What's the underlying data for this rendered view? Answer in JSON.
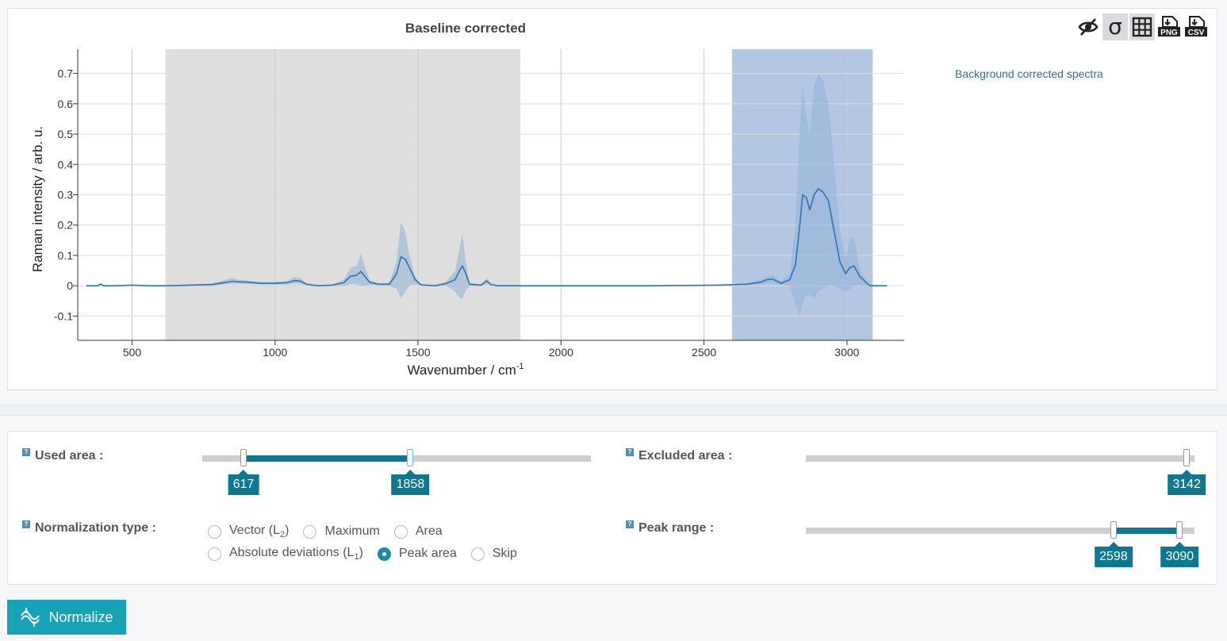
{
  "chart_data": {
    "type": "line",
    "title": "Baseline corrected",
    "xlabel": "Wavenumber / cm",
    "xlabel_sup": "-1",
    "ylabel": "Raman intensity / arb. u.",
    "xlim": [
      310,
      3200
    ],
    "ylim": [
      -0.18,
      0.78
    ],
    "xticks": [
      500,
      1000,
      1500,
      2000,
      2500,
      3000
    ],
    "yticks": [
      -0.1,
      0,
      0.1,
      0.2,
      0.3,
      0.4,
      0.5,
      0.6,
      0.7
    ],
    "ytick_labels": [
      "-0.1",
      "0",
      "0.1",
      "0.2",
      "0.3",
      "0.4",
      "0.5",
      "0.6",
      "0.7"
    ],
    "grid": true,
    "regions": [
      {
        "role": "used-area",
        "from": 617,
        "to": 1858,
        "color": "#dedede"
      },
      {
        "role": "peak-range",
        "from": 2598,
        "to": 3090,
        "color": "#b4c7e2"
      }
    ],
    "series": [
      {
        "name": "Background corrected spectra",
        "color": "#2a76b5",
        "x": [
          340,
          380,
          390,
          400,
          440,
          500,
          560,
          600,
          620,
          700,
          780,
          820,
          850,
          870,
          900,
          950,
          1000,
          1040,
          1070,
          1090,
          1110,
          1150,
          1200,
          1240,
          1265,
          1285,
          1300,
          1315,
          1330,
          1360,
          1400,
          1425,
          1440,
          1455,
          1470,
          1490,
          1510,
          1560,
          1600,
          1630,
          1645,
          1655,
          1665,
          1680,
          1720,
          1740,
          1755,
          1780,
          1850,
          2000,
          2300,
          2550,
          2650,
          2700,
          2720,
          2740,
          2770,
          2800,
          2820,
          2835,
          2845,
          2858,
          2870,
          2885,
          2900,
          2915,
          2935,
          2955,
          2975,
          2995,
          3010,
          3025,
          3045,
          3080,
          3140
        ],
        "y": [
          0.0,
          0.0,
          0.006,
          0.0,
          0.0,
          0.002,
          0.0,
          0.0,
          0.0,
          0.002,
          0.004,
          0.01,
          0.015,
          0.013,
          0.012,
          0.008,
          0.008,
          0.01,
          0.017,
          0.015,
          0.005,
          0.0,
          0.002,
          0.01,
          0.032,
          0.034,
          0.047,
          0.03,
          0.012,
          0.005,
          0.005,
          0.04,
          0.095,
          0.088,
          0.06,
          0.02,
          0.003,
          0.0,
          0.008,
          0.02,
          0.05,
          0.065,
          0.045,
          0.005,
          0.002,
          0.016,
          0.004,
          0.0,
          0.0,
          0.0,
          0.0,
          0.002,
          0.005,
          0.012,
          0.02,
          0.022,
          0.008,
          0.02,
          0.07,
          0.2,
          0.3,
          0.29,
          0.25,
          0.3,
          0.32,
          0.31,
          0.28,
          0.18,
          0.08,
          0.04,
          0.06,
          0.065,
          0.03,
          0.0,
          0.0
        ],
        "band_upper": [
          0.0,
          0.0,
          0.008,
          0.0,
          0.0,
          0.003,
          0.0,
          0.0,
          0.0,
          0.004,
          0.008,
          0.018,
          0.026,
          0.02,
          0.018,
          0.012,
          0.012,
          0.016,
          0.03,
          0.025,
          0.008,
          0.0,
          0.004,
          0.02,
          0.06,
          0.065,
          0.105,
          0.06,
          0.02,
          0.008,
          0.01,
          0.08,
          0.21,
          0.18,
          0.1,
          0.03,
          0.005,
          0.0,
          0.015,
          0.05,
          0.12,
          0.175,
          0.09,
          0.01,
          0.004,
          0.025,
          0.006,
          0.0,
          0.0,
          0.0,
          0.0,
          0.003,
          0.008,
          0.02,
          0.03,
          0.035,
          0.015,
          0.04,
          0.2,
          0.52,
          0.66,
          0.56,
          0.5,
          0.66,
          0.7,
          0.68,
          0.6,
          0.4,
          0.18,
          0.09,
          0.15,
          0.16,
          0.05,
          0.0,
          0.0
        ],
        "band_lower": [
          0.0,
          0.0,
          0.004,
          0.0,
          0.0,
          0.001,
          0.0,
          0.0,
          0.0,
          0.0,
          0.0,
          0.004,
          0.007,
          0.006,
          0.006,
          0.004,
          0.004,
          0.004,
          0.007,
          0.006,
          0.002,
          0.0,
          0.0,
          0.0,
          0.005,
          0.005,
          0.0,
          0.0,
          0.002,
          0.002,
          0.0,
          -0.01,
          -0.04,
          -0.02,
          0.0,
          0.005,
          0.001,
          0.0,
          0.0,
          -0.02,
          -0.04,
          -0.045,
          -0.02,
          0.0,
          0.0,
          0.005,
          0.002,
          0.0,
          0.0,
          0.0,
          0.0,
          0.001,
          0.002,
          0.004,
          0.008,
          0.008,
          0.002,
          0.0,
          -0.06,
          -0.1,
          -0.06,
          -0.03,
          -0.03,
          -0.04,
          -0.02,
          -0.01,
          0.0,
          0.0,
          -0.01,
          -0.02,
          -0.01,
          0.0,
          0.0,
          0.0,
          0.0
        ],
        "band_color": "#8fb0d6"
      }
    ]
  },
  "legend": {
    "label": "Background corrected spectra"
  },
  "toolbar": {
    "icons": [
      "eye-slash-icon",
      "sigma-icon",
      "grid-icon",
      "png-download-icon",
      "csv-download-icon"
    ],
    "sigma_glyph": "σ",
    "png_label": "PNG",
    "csv_label": "CSV"
  },
  "controls": {
    "help_glyph": "?",
    "used_area": {
      "label": "Used area :",
      "min": 310,
      "max": 3200,
      "low": 617,
      "high": 1858,
      "low_label": "617",
      "high_label": "1858"
    },
    "excluded_area": {
      "label": "Excluded area :",
      "min": 310,
      "max": 3200,
      "value": 3142,
      "value_label": "3142"
    },
    "normalization": {
      "label": "Normalization type :",
      "options": [
        {
          "label": "Vector (L",
          "sub": "2",
          "tail": ")",
          "checked": false
        },
        {
          "label": "Maximum",
          "sub": "",
          "tail": "",
          "checked": false
        },
        {
          "label": "Area",
          "sub": "",
          "tail": "",
          "checked": false
        },
        {
          "label": "Absolute deviations (L",
          "sub": "1",
          "tail": ")",
          "checked": false
        },
        {
          "label": "Peak area",
          "sub": "",
          "tail": "",
          "checked": true
        },
        {
          "label": "Skip",
          "sub": "",
          "tail": "",
          "checked": false
        }
      ]
    },
    "peak_range": {
      "label": "Peak range :",
      "min": 310,
      "max": 3200,
      "low": 2598,
      "high": 3090,
      "low_label": "2598",
      "high_label": "3090"
    }
  },
  "normalize_button": {
    "label": "Normalize"
  }
}
